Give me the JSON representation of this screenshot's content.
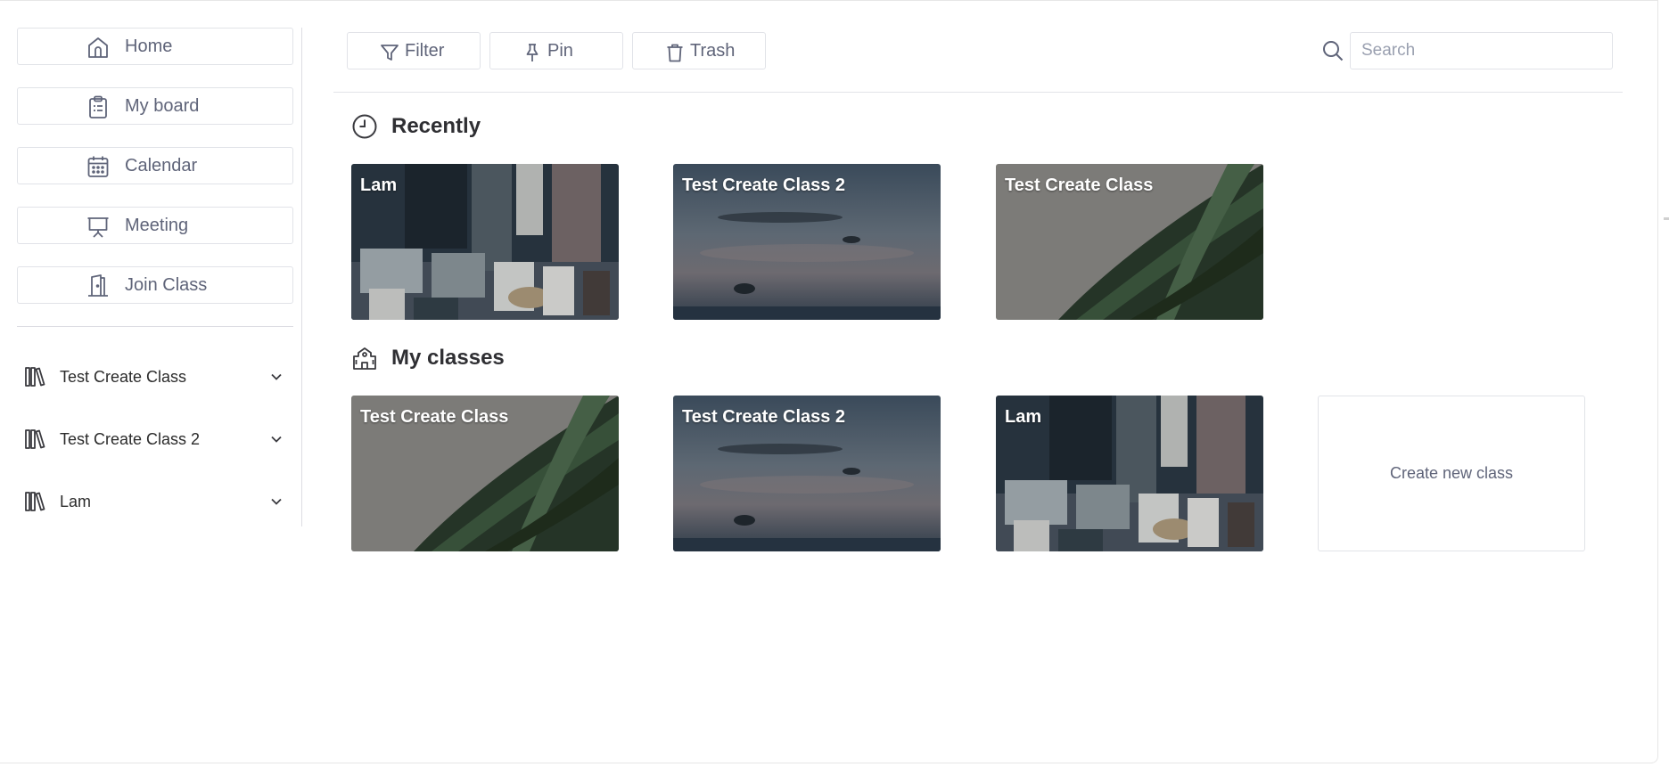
{
  "sidebar": {
    "nav": [
      {
        "label": "Home",
        "icon": "home-icon"
      },
      {
        "label": "My board",
        "icon": "clipboard-icon"
      },
      {
        "label": "Calendar",
        "icon": "calendar-icon"
      },
      {
        "label": "Meeting",
        "icon": "presentation-icon"
      },
      {
        "label": "Join Class",
        "icon": "door-icon"
      }
    ],
    "classes": [
      {
        "label": "Test Create Class",
        "icon": "library-icon"
      },
      {
        "label": "Test Create Class 2",
        "icon": "library-icon"
      },
      {
        "label": "Lam",
        "icon": "library-icon"
      }
    ]
  },
  "toolbar": {
    "filter_label": "Filter",
    "pin_label": "Pin",
    "trash_label": "Trash",
    "search_placeholder": "Search",
    "search_value": ""
  },
  "recent": {
    "title": "Recently",
    "icon": "clock-icon",
    "cards": [
      {
        "title": "Lam",
        "image": "city-aerial"
      },
      {
        "title": "Test Create Class 2",
        "image": "sea-dusk"
      },
      {
        "title": "Test Create Class",
        "image": "palm-leaf"
      }
    ]
  },
  "my_classes": {
    "title": "My classes",
    "icon": "school-building-icon",
    "cards": [
      {
        "title": "Test Create Class",
        "image": "palm-leaf"
      },
      {
        "title": "Test Create Class 2",
        "image": "sea-dusk"
      },
      {
        "title": "Lam",
        "image": "city-aerial"
      }
    ],
    "create_label": "Create new class"
  },
  "colors": {
    "border": "#e1e3e8",
    "muted_text": "#5f6479",
    "heading_text": "#2f2f33"
  }
}
